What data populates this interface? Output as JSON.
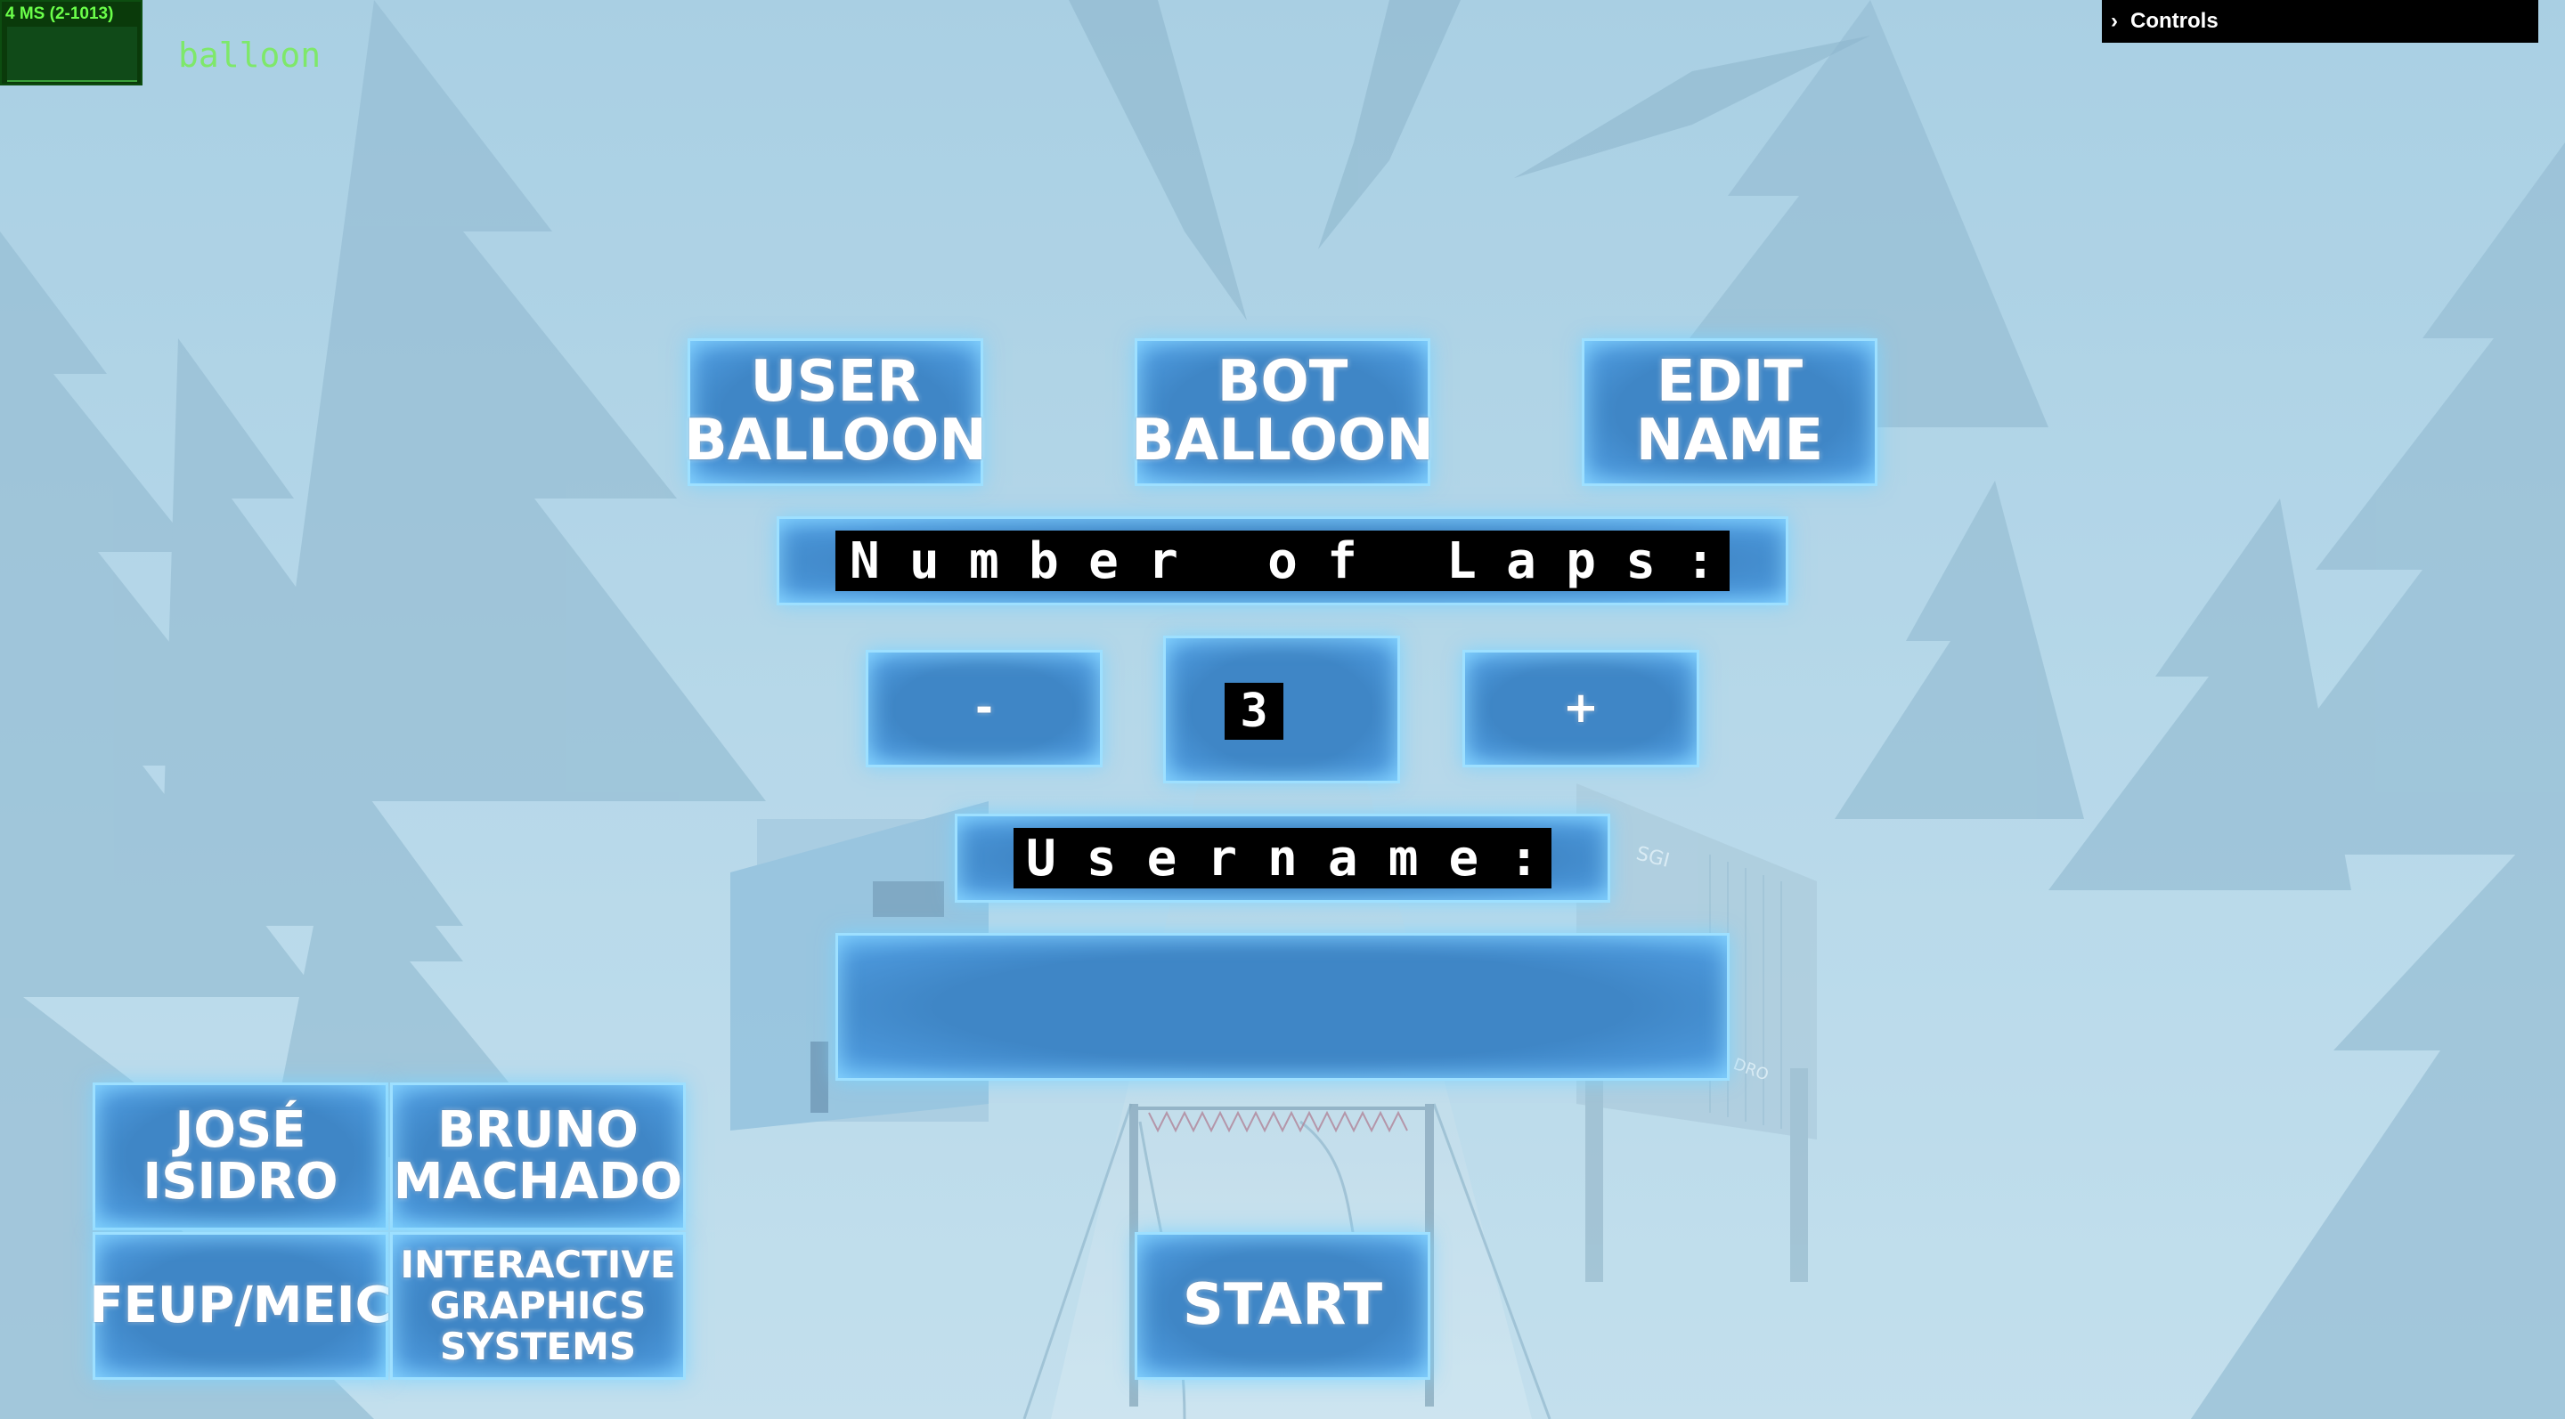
{
  "stats": {
    "text": "4 MS (2-1013)"
  },
  "selected_name": "balloon",
  "controls": {
    "label": "Controls",
    "icon": "chevron-right-icon"
  },
  "menu": {
    "user_balloon": "USER\nBALLOON",
    "bot_balloon": "BOT\nBALLOON",
    "edit_name": "EDIT\nNAME",
    "laps_label": [
      "N",
      "u",
      "m",
      "b",
      "e",
      "r",
      "",
      "o",
      "f",
      "",
      "L",
      "a",
      "p",
      "s",
      ":"
    ],
    "minus": "-",
    "laps_value": "3",
    "plus": "+",
    "username_label": [
      "U",
      "s",
      "e",
      "r",
      "n",
      "a",
      "m",
      "e",
      ":"
    ],
    "username_value": "",
    "start": "START"
  },
  "credits": {
    "author1": "JOSÉ\nISIDRO",
    "author2": "BRUNO\nMACHADO",
    "school": "FEUP/MEIC",
    "course": "INTERACTIVE\nGRAPHICS\nSYSTEMS"
  },
  "scenery": {
    "banner_left": "",
    "banner_right_1": "SGI",
    "banner_right_2": "DRO"
  },
  "colors": {
    "panel_blue": "#3f86c6",
    "panel_glow": "#9ee0ff",
    "fog": "#b4d5e6",
    "stats_green": "#6bff4a"
  }
}
